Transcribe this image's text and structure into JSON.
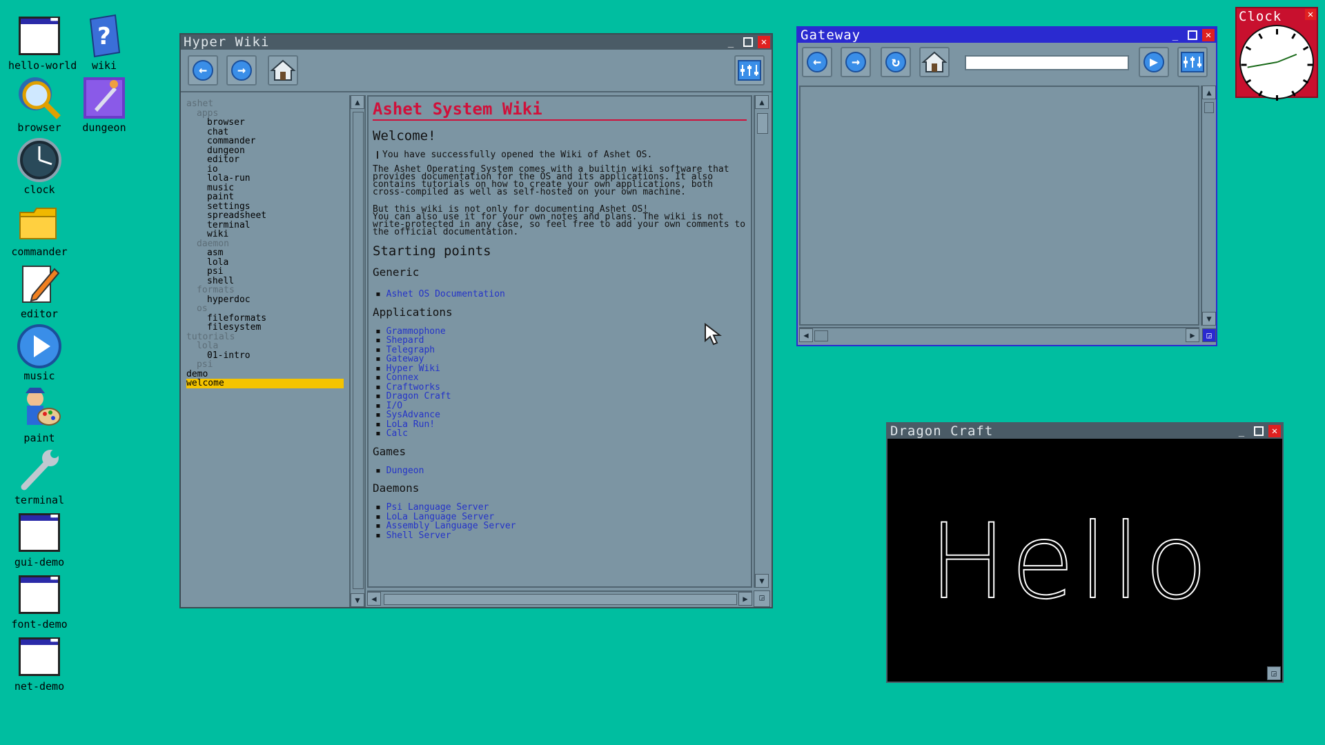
{
  "desktop": {
    "icons": [
      {
        "label": "hello-world",
        "icon": "window-icon"
      },
      {
        "label": "wiki",
        "icon": "help-book-icon"
      },
      {
        "label": "browser",
        "icon": "magnifier-globe-icon"
      },
      {
        "label": "dungeon",
        "icon": "dungeon-game-icon"
      },
      {
        "label": "clock",
        "icon": "clock-icon"
      },
      {
        "label": "commander",
        "icon": "folder-icon"
      },
      {
        "label": "editor",
        "icon": "pencil-document-icon"
      },
      {
        "label": "music",
        "icon": "play-icon"
      },
      {
        "label": "paint",
        "icon": "painter-palette-icon"
      },
      {
        "label": "terminal",
        "icon": "wrench-icon"
      },
      {
        "label": "gui-demo",
        "icon": "window-icon"
      },
      {
        "label": "font-demo",
        "icon": "window-icon"
      },
      {
        "label": "net-demo",
        "icon": "window-icon"
      }
    ]
  },
  "hyperwiki": {
    "title": "Hyper Wiki",
    "toolbar": {
      "back_icon": "back-arrow-icon",
      "forward_icon": "forward-arrow-icon",
      "home_icon": "home-icon",
      "menu_icon": "menu-icon"
    },
    "tree": [
      {
        "text": "ashet",
        "indent": 0,
        "dim": true
      },
      {
        "text": "apps",
        "indent": 1,
        "dim": true
      },
      {
        "text": "browser",
        "indent": 2
      },
      {
        "text": "chat",
        "indent": 2
      },
      {
        "text": "commander",
        "indent": 2
      },
      {
        "text": "dungeon",
        "indent": 2
      },
      {
        "text": "editor",
        "indent": 2
      },
      {
        "text": "io",
        "indent": 2
      },
      {
        "text": "lola-run",
        "indent": 2
      },
      {
        "text": "music",
        "indent": 2
      },
      {
        "text": "paint",
        "indent": 2
      },
      {
        "text": "settings",
        "indent": 2
      },
      {
        "text": "spreadsheet",
        "indent": 2
      },
      {
        "text": "terminal",
        "indent": 2
      },
      {
        "text": "wiki",
        "indent": 2
      },
      {
        "text": "daemon",
        "indent": 1,
        "dim": true
      },
      {
        "text": "asm",
        "indent": 2
      },
      {
        "text": "lola",
        "indent": 2
      },
      {
        "text": "psi",
        "indent": 2
      },
      {
        "text": "shell",
        "indent": 2
      },
      {
        "text": "formats",
        "indent": 1,
        "dim": true
      },
      {
        "text": "hyperdoc",
        "indent": 2
      },
      {
        "text": "os",
        "indent": 1,
        "dim": true
      },
      {
        "text": "fileformats",
        "indent": 2
      },
      {
        "text": "filesystem",
        "indent": 2
      },
      {
        "text": "tutorials",
        "indent": 0,
        "dim": true
      },
      {
        "text": "lola",
        "indent": 1,
        "dim": true
      },
      {
        "text": "01-intro",
        "indent": 2
      },
      {
        "text": "psi",
        "indent": 1,
        "dim": true
      },
      {
        "text": "demo",
        "indent": 0
      },
      {
        "text": "welcome",
        "indent": 0,
        "selected": true
      }
    ],
    "doc": {
      "title": "Ashet System Wiki",
      "welcome_heading": "Welcome!",
      "quote": "You have successfully opened the Wiki of Ashet OS.",
      "para1": "The Ashet Operating System comes with a builtin wiki software that provides documentation for the OS and its applications. It also contains tutorials on how to create your own applications, both cross-compiled as well as self-hosted on your own machine.",
      "para2_line1": "But this wiki is not only for documenting Ashet OS!",
      "para2_line2": "You can also use it for your own notes and plans. The wiki is not write-protected in any case, so feel free to add your own comments to the official documentation.",
      "starting_points_heading": "Starting points",
      "generic_heading": "Generic",
      "generic_links": [
        "Ashet OS Documentation"
      ],
      "applications_heading": "Applications",
      "application_links": [
        "Grammophone",
        "Shepard",
        "Telegraph",
        "Gateway",
        "Hyper Wiki",
        "Connex",
        "Craftworks",
        "Dragon Craft",
        "I/O",
        "SysAdvance",
        "LoLa Run!",
        "Calc"
      ],
      "games_heading": "Games",
      "game_links": [
        "Dungeon"
      ],
      "daemons_heading": "Daemons",
      "daemon_links": [
        "Psi Language Server",
        "LoLa Language Server",
        "Assembly Language Server",
        "Shell Server"
      ]
    }
  },
  "gateway": {
    "title": "Gateway",
    "address_value": "",
    "toolbar": {
      "back_icon": "back-arrow-icon",
      "forward_icon": "forward-arrow-icon",
      "reload_icon": "reload-icon",
      "home_icon": "home-icon",
      "go_icon": "go-icon",
      "menu_icon": "menu-icon"
    }
  },
  "clock": {
    "title": "Clock",
    "hour_hand_deg": -112,
    "minute_hand_deg": 80
  },
  "dragoncraft": {
    "title": "Dragon Craft",
    "canvas_text": "Hello"
  },
  "colors": {
    "desktop": "#00bea0",
    "window": "#7c95a3",
    "titlebar": "#4a5b66",
    "gateway_titlebar": "#2a2ad0",
    "close": "#e02020",
    "link": "#2433c8",
    "wiki_title": "#d0103a",
    "selection": "#f5c400"
  }
}
